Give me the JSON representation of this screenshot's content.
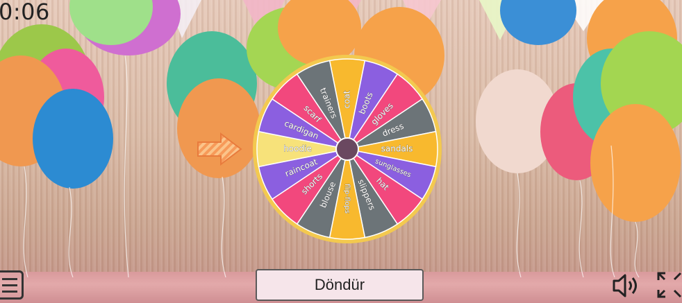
{
  "game": {
    "timer": "0:06",
    "spin_button_label": "Döndür",
    "wheel_items": [
      "coat",
      "boots",
      "gloves",
      "dress",
      "sandals",
      "sunglasses",
      "hat",
      "slippers",
      "flip-flops",
      "blouse",
      "shorts",
      "raincoat",
      "hoodie",
      "cardigan",
      "scarf",
      "trainers"
    ],
    "segment_colors": [
      "#f8b92e",
      "#8b5fe0",
      "#f2487d",
      "#6c7478",
      "#f8b92e",
      "#8b5fe0",
      "#f2487d",
      "#6c7478",
      "#f8b92e",
      "#6c7478",
      "#f2487d",
      "#8b5fe0",
      "#f7e27a",
      "#8b5fe0",
      "#f2487d",
      "#6c7478"
    ],
    "rim_color": "#f3c94f",
    "hub_color": "#6a4860",
    "pointer_color": "#f7a35c",
    "icons": {
      "menu": "menu-icon",
      "sound": "volume-icon",
      "fullscreen": "fullscreen-icon",
      "pointer": "arrow-pointer-icon"
    }
  }
}
